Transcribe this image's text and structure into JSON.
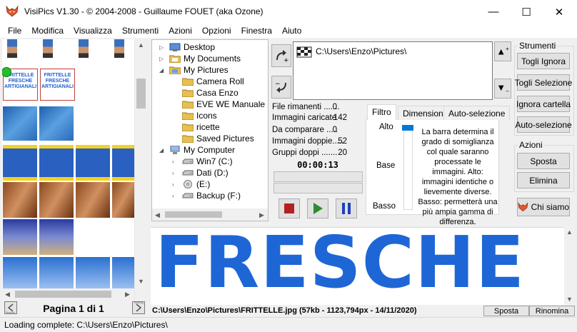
{
  "window": {
    "title": "VisiPics V1.30 - © 2004-2008 - Guillaume FOUET (aka Ozone)",
    "minimize_glyph": "—",
    "maximize_glyph": "☐",
    "close_glyph": "✕"
  },
  "menu": [
    "File",
    "Modifica",
    "Visualizza",
    "Strumenti",
    "Azioni",
    "Opzioni",
    "Finestra",
    "Aiuto"
  ],
  "thumbnails": {
    "card_lines": [
      "FRITTELLE",
      "FRESCHE",
      "ARTIGIANALI"
    ],
    "page_label": "Pagina 1 di 1"
  },
  "tree": {
    "items": [
      {
        "label": "Desktop",
        "icon": "desktop-icon",
        "level": 0
      },
      {
        "label": "My Documents",
        "icon": "documents-folder-icon",
        "level": 0
      },
      {
        "label": "My Pictures",
        "icon": "pictures-folder-icon",
        "level": 0
      },
      {
        "label": "Camera Roll",
        "icon": "folder-icon",
        "level": 1
      },
      {
        "label": "Casa Enzo",
        "icon": "folder-icon",
        "level": 1
      },
      {
        "label": "EVE WE Manuale ut",
        "icon": "folder-icon",
        "level": 1
      },
      {
        "label": "Icons",
        "icon": "folder-icon",
        "level": 1
      },
      {
        "label": "ricette",
        "icon": "folder-icon",
        "level": 1
      },
      {
        "label": "Saved Pictures",
        "icon": "folder-icon",
        "level": 1
      },
      {
        "label": "My Computer",
        "icon": "computer-icon",
        "level": 0
      },
      {
        "label": "Win7 (C:)",
        "icon": "drive-icon",
        "level": 1
      },
      {
        "label": "Dati (D:)",
        "icon": "drive-icon",
        "level": 1
      },
      {
        "label": "(E:)",
        "icon": "cd-drive-icon",
        "level": 1
      },
      {
        "label": "Backup (F:)",
        "icon": "drive-icon",
        "level": 1
      }
    ]
  },
  "folders": {
    "path": "C:\\Users\\Enzo\\Pictures\\"
  },
  "stats": {
    "rows": [
      {
        "label": "File rimanenti .......",
        "value": "0"
      },
      {
        "label": "Immagini caricate",
        "value": "142"
      },
      {
        "label": "Da comparare .....",
        "value": "0"
      },
      {
        "label": "Immagini doppie.....",
        "value": "52"
      },
      {
        "label": "Gruppi doppi .......",
        "value": "20"
      }
    ],
    "timer": "00:00:13"
  },
  "tabs": {
    "items": [
      "Filtro",
      "Dimensioni",
      "Auto-selezione"
    ],
    "active": "Filtro",
    "slider_labels": {
      "high": "Alto",
      "mid": "Base",
      "low": "Basso"
    },
    "description": "La barra determina il grado di somiglianza col quale saranno processate le immagini. Alto: immagini identiche o lievemente diverse. Basso: permetterà una più ampia gamma di differenza."
  },
  "tools": {
    "group_label": "Strumenti",
    "buttons": [
      "Togli Ignora",
      "Togli Selezione",
      "Ignora cartella",
      "Auto-selezione"
    ]
  },
  "actions": {
    "group_label": "Azioni",
    "buttons": [
      "Sposta",
      "Elimina"
    ],
    "about": "Chi siamo"
  },
  "preview": {
    "text": "FRESCHE",
    "info": "C:\\Users\\Enzo\\Pictures\\FRITTELLE.jpg (57kb - 1123,794px - 14/11/2020)",
    "move_button": "Sposta",
    "rename_button": "Rinomina"
  },
  "status": {
    "text": "Loading complete: C:\\Users\\Enzo\\Pictures\\"
  },
  "colors": {
    "accent": "#0078d7",
    "preview_text": "#1e66d6",
    "stop": "#b22222",
    "play": "#2e8b2e",
    "pause": "#1f3fbf"
  }
}
